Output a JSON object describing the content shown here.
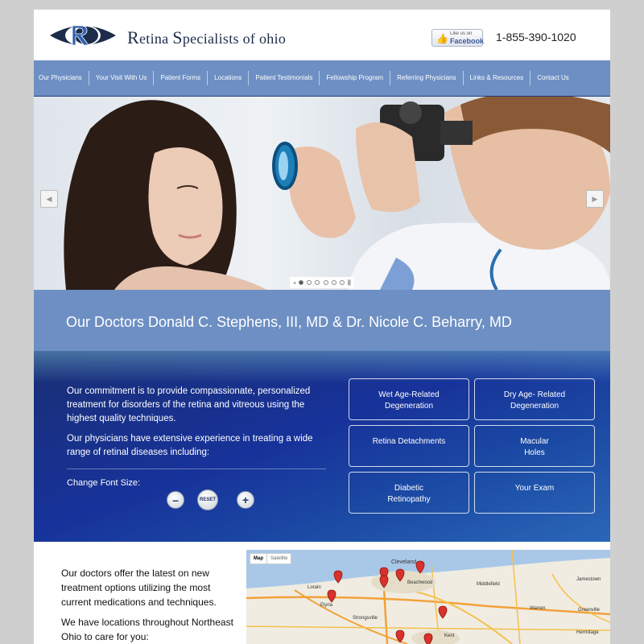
{
  "header": {
    "brand_big": "R",
    "brand_rest": "etina ",
    "brand_big2": "S",
    "brand_rest2": "pecialists of ohio",
    "facebook_line1": "Like us on",
    "facebook_line2": "Facebook",
    "phone": "1-855-390-1020"
  },
  "nav": [
    "Our Physicians",
    "Your Visit With Us",
    "Patient Forms",
    "Locations",
    "Patient Testimonials",
    "Fellowship Program",
    "Referring Physicians",
    "Links & Resources",
    "Contact Us"
  ],
  "hero": {
    "prev_icon": "◀",
    "next_icon": "▶",
    "pause_icon": "||"
  },
  "doctors_heading": "Our Doctors Donald C. Stephens, III, MD & Dr. Nicole C. Beharry, MD",
  "info": {
    "paragraph1": "Our commitment is to provide compassionate, personalized treatment for disorders of the retina and vitreous using the highest quality techniques.",
    "paragraph2": "Our physicians have extensive experience in treating a wide range of retinal diseases including:",
    "font_size_label": "Change Font Size:",
    "decrease_label": "–",
    "reset_label": "RESET",
    "increase_label": "+",
    "tiles": [
      "Wet Age-Related\nDegeneration",
      "Dry Age- Related\nDegeneration",
      "Retina Detachments",
      "Macular\nHoles",
      "Diabetic\nRetinopathy",
      "Your Exam"
    ]
  },
  "bottom": {
    "paragraph1": "Our doctors offer the latest on new treatment options utilizing the most current medications and techniques.",
    "paragraph2": "We have locations throughout Northeast Ohio to care for you:"
  },
  "map": {
    "type_map": "Map",
    "type_satellite": "Satellite",
    "cities": [
      "Cleveland",
      "Beachwood",
      "Lorain",
      "Elyria",
      "Middlefield",
      "Jamestown",
      "Strongsville",
      "Warren",
      "Greenville",
      "Kent",
      "Hermitage"
    ]
  },
  "colors": {
    "nav_bg": "#6d8fc3",
    "nav_band": "#1c3e7c",
    "info_bg": "#17329a",
    "pin": "#d9312b"
  }
}
